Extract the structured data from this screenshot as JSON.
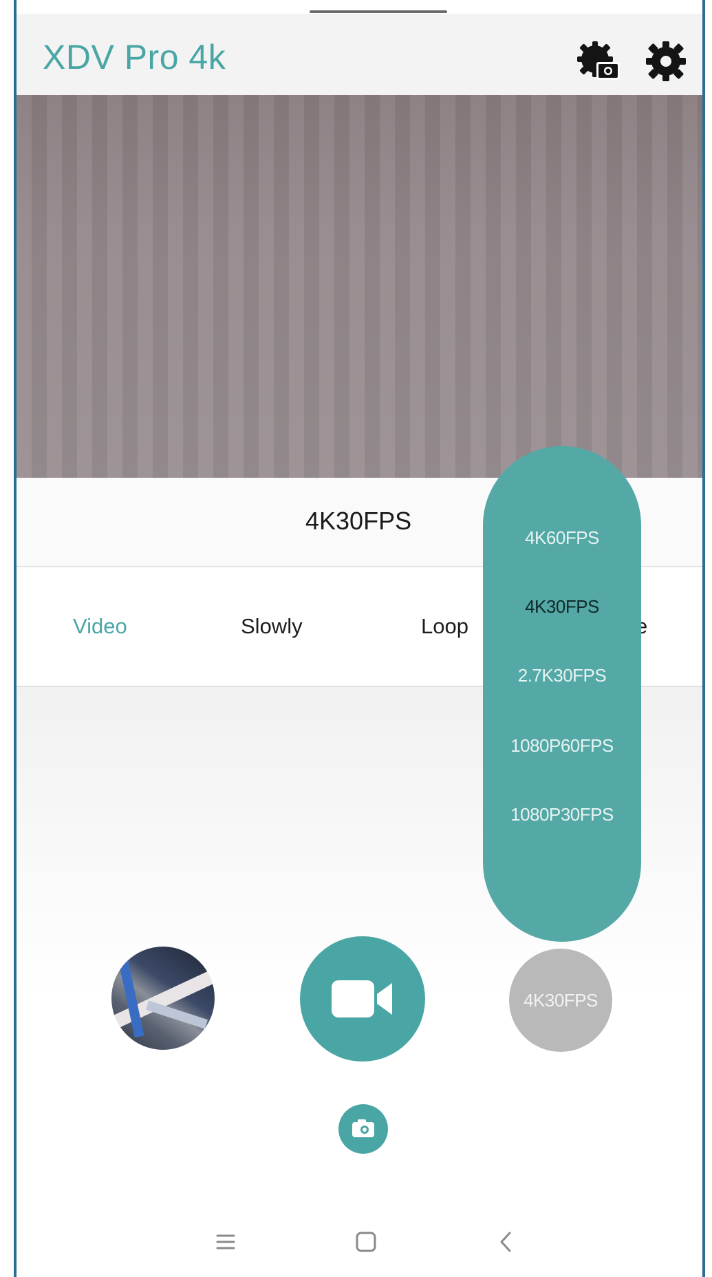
{
  "app": {
    "title": "XDV Pro 4k"
  },
  "header_icons": [
    "camera-settings-icon",
    "gear-icon"
  ],
  "resolution": {
    "current": "4K30FPS",
    "options": [
      "4K60FPS",
      "4K30FPS",
      "2.7K30FPS",
      "1080P60FPS",
      "1080P30FPS"
    ],
    "selected": "4K30FPS"
  },
  "modes": {
    "video": "Video",
    "slowly": "Slowly",
    "loop": "Loop",
    "partial": "e",
    "active": "Video"
  },
  "controls": {
    "badge": "4K30FPS",
    "record_icon": "video-camera-icon",
    "photo_icon": "photo-camera-icon"
  },
  "colors": {
    "accent": "#4aa6a5",
    "dropdown_bg": "#54a8a6",
    "badge_bg": "#b9b9b9"
  },
  "navigation": [
    "menu-icon",
    "home-icon",
    "back-icon"
  ]
}
